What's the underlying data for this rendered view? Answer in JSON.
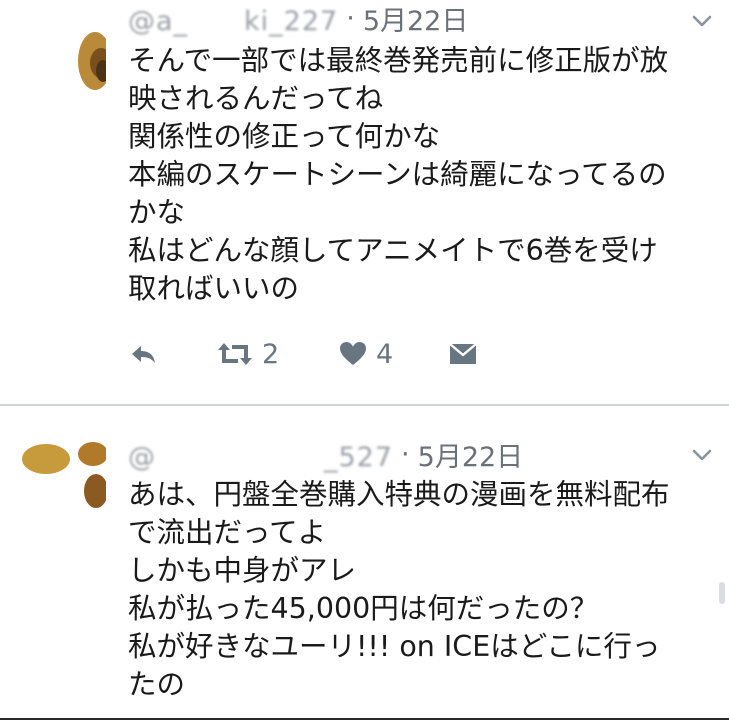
{
  "tweets": [
    {
      "handle_partial": "@a_　　ki_227",
      "separator": "·",
      "date": "5月22日",
      "text": "そんで一部では最終巻発売前に修正版が放\n映されるんだってね\n関係性の修正って何かな\n本編のスケートシーンは綺麗になってるの\nかな\n私はどんな顔してアニメイトで6巻を受け\n取ればいいの",
      "actions": {
        "reply_icon": "reply-icon",
        "retweet_icon": "retweet-icon",
        "retweet_count": "2",
        "like_icon": "heart-icon",
        "like_count": "4",
        "dm_icon": "direct-message-icon"
      }
    },
    {
      "handle_partial": "@　　　　　　_527",
      "separator": "·",
      "date": "5月22日",
      "text": "あは、円盤全巻購入特典の漫画を無料配布\nで流出だってよ\nしかも中身がアレ\n私が払った45,000円は何だったの？\n私が好きなユーリ!!! on ICEはどこに行っ\nたの"
    }
  ],
  "colors": {
    "text": "#1a1a1a",
    "meta": "#6b7178",
    "icon": "#687682",
    "divider": "#cfd4d9"
  }
}
